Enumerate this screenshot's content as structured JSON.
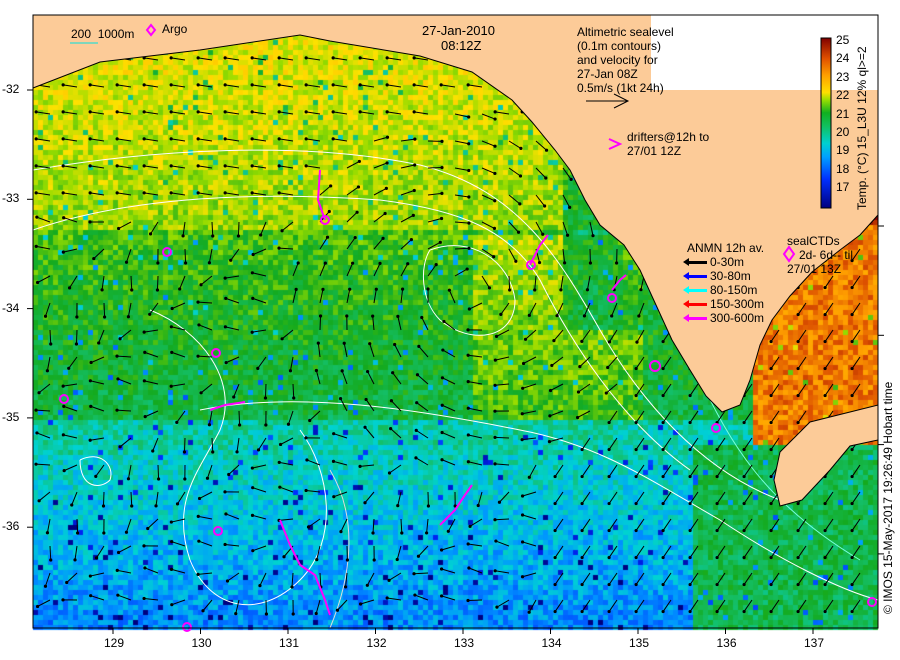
{
  "header": {
    "date": "27-Jan-2010",
    "time": "08:12Z"
  },
  "legend_top_left": {
    "isobath_200": "200",
    "isobath_1000": "1000m",
    "argo_label": "Argo",
    "isobath_color": "#00e0e0",
    "argo_color": "#ff00ff"
  },
  "altimetry_note": {
    "lines": [
      "Altimetric sealevel",
      "(0.1m contours)",
      "and velocity for",
      "27-Jan 08Z",
      "0.5m/s (1kt 24h)"
    ]
  },
  "drifters_note": {
    "lines": [
      "drifters@12h to",
      "27/01 12Z"
    ],
    "color": "#ff00ff"
  },
  "anmn_legend": {
    "title": "ANMN 12h av.",
    "items": [
      {
        "label": "0-30m",
        "color": "#000000"
      },
      {
        "label": "30-80m",
        "color": "#0000ff"
      },
      {
        "label": "80-150m",
        "color": "#00ffff"
      },
      {
        "label": "150-300m",
        "color": "#ff0000"
      },
      {
        "label": "300-600m",
        "color": "#ff00ff"
      }
    ]
  },
  "seal_legend": {
    "title": "sealCTDs",
    "line1": "2d- 6d-- til",
    "line2": "27/01 13Z"
  },
  "colorbar": {
    "label": "Temp. (°C) 15_L3U 12% ql>=2",
    "ticks": [
      "25",
      "24",
      "23",
      "22",
      "21",
      "20",
      "19",
      "18",
      "17"
    ],
    "range": [
      16.5,
      25
    ]
  },
  "axes": {
    "x_ticks": [
      "129",
      "130",
      "131",
      "132",
      "133",
      "134",
      "135",
      "136",
      "137"
    ],
    "y_ticks": [
      "-32",
      "-33",
      "-34",
      "-35",
      "-36"
    ]
  },
  "credit": "© IMOS 15-May-2017 19:26:49 Hobart time",
  "colors": {
    "land": "#fccb98",
    "contour": "#ffffff",
    "seal_marker": "#ff00ff"
  }
}
